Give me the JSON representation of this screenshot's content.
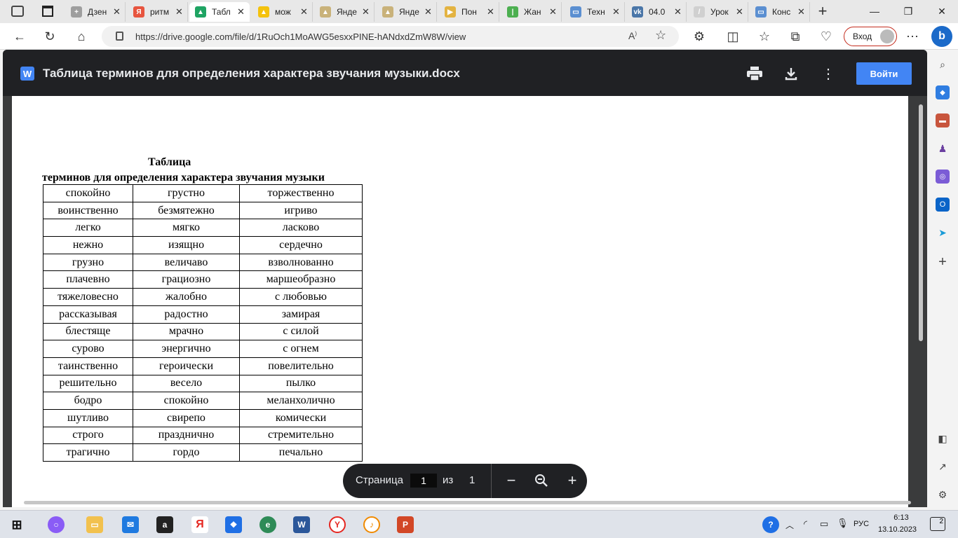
{
  "browser": {
    "tabs": [
      {
        "label": "Дзен",
        "color": "#9e9e9e",
        "glyph": "+"
      },
      {
        "label": "ритм",
        "color": "#e7553f",
        "glyph": "Я"
      },
      {
        "label": "Табл",
        "color": "#1fa463",
        "glyph": "▲",
        "active": true
      },
      {
        "label": "мож",
        "color": "#f4c20d",
        "glyph": "▲"
      },
      {
        "label": "Янде",
        "color": "#c9b27a",
        "glyph": "▲"
      },
      {
        "label": "Янде",
        "color": "#c9b27a",
        "glyph": "▲"
      },
      {
        "label": "Пон",
        "color": "#e3b341",
        "glyph": "▶"
      },
      {
        "label": "Жан",
        "color": "#4caf50",
        "glyph": "|"
      },
      {
        "label": "Техн",
        "color": "#5b8fd1",
        "glyph": "▭"
      },
      {
        "label": "04.0",
        "color": "#4a76a8",
        "glyph": "vk"
      },
      {
        "label": "Урок",
        "color": "#d0d0d0",
        "glyph": "/"
      },
      {
        "label": "Конс",
        "color": "#5b8fd1",
        "glyph": "▭"
      }
    ],
    "url": "https://drive.google.com/file/d/1RuOch1MoAWG5esxxPINE-hANdxdZmW8W/view",
    "signin_label": "Вход"
  },
  "viewer": {
    "doc_title": "Таблица терминов для определения характера звучания музыки.docx",
    "app_badge": "W",
    "login_label": "Войти"
  },
  "document": {
    "caption_line1": "Таблица",
    "caption_line2": "терминов для определения характера звучания музыки",
    "rows": [
      [
        "спокойно",
        "грустно",
        "торжественно"
      ],
      [
        "воинственно",
        "безмятежно",
        "игриво"
      ],
      [
        "легко",
        "мягко",
        "ласково"
      ],
      [
        "нежно",
        "изящно",
        "сердечно"
      ],
      [
        "грузно",
        "величаво",
        "взволнованно"
      ],
      [
        "плачевно",
        "грациозно",
        "маршеобразно"
      ],
      [
        "тяжеловесно",
        "жалобно",
        "с любовью"
      ],
      [
        "рассказывая",
        "радостно",
        "замирая"
      ],
      [
        "блестяще",
        "мрачно",
        "с силой"
      ],
      [
        "сурово",
        "энергично",
        "с огнем"
      ],
      [
        "таинственно",
        "героически",
        "повелительно"
      ],
      [
        "решительно",
        "весело",
        "пылко"
      ],
      [
        "бодро",
        "спокойно",
        "меланхолично"
      ],
      [
        "шутливо",
        "свирепо",
        "комически"
      ],
      [
        "строго",
        "празднично",
        "стремительно"
      ],
      [
        "трагично",
        "гордо",
        "печально"
      ]
    ]
  },
  "page_nav": {
    "label": "Страница",
    "current": "1",
    "of": "из",
    "total": "1"
  },
  "taskbar": {
    "lang": "РУС",
    "time": "6:13",
    "date": "13.10.2023",
    "notifications": "2"
  }
}
